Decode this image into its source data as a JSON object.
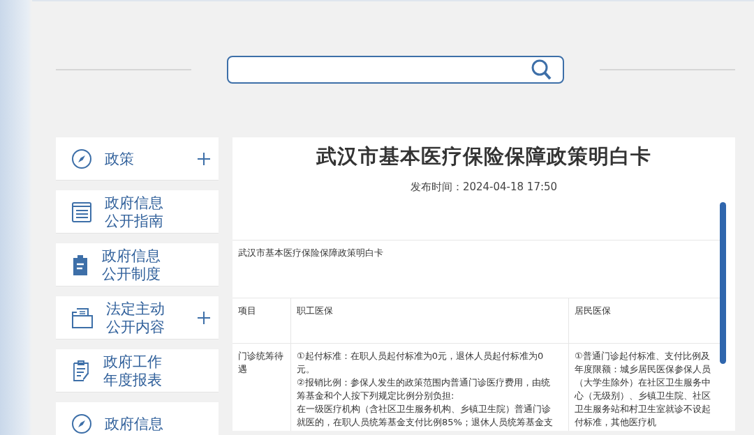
{
  "sidebar": {
    "items": [
      {
        "kind": "compass",
        "lines": [
          "政策"
        ],
        "expandable": true
      },
      {
        "kind": "list",
        "lines": [
          "政府信息",
          "公开指南"
        ],
        "expandable": false
      },
      {
        "kind": "clipboard",
        "lines": [
          "政府信息",
          "公开制度"
        ],
        "expandable": false
      },
      {
        "kind": "folder",
        "lines": [
          "法定主动",
          "公开内容"
        ],
        "expandable": true
      },
      {
        "kind": "report",
        "lines": [
          "政府工作",
          "年度报表"
        ],
        "expandable": false
      },
      {
        "kind": "compass",
        "lines": [
          "政府信息"
        ],
        "expandable": false
      }
    ]
  },
  "article": {
    "title": "武汉市基本医疗保险保障政策明白卡",
    "date_label": "发布时间：",
    "date": "2024-04-18 17:50",
    "table": {
      "caption": "武汉市基本医疗保险保障政策明白卡",
      "header": [
        "项目",
        "职工医保",
        "居民医保"
      ],
      "rows": [
        {
          "cells": [
            [
              "门诊统筹待遇"
            ],
            [
              "①起付标准：在职人员起付标准为0元，退休人员起付标准为0元。",
              "②报销比例：参保人发生的政策范围内普通门诊医疗费用，由统筹基金和个人按下列规定比例分别负担:",
              "在一级医疗机构（含社区卫生服务机构、乡镇卫生院）普通门诊就医的，在职人员统筹基金支付比例85%；退休人员统筹基金支"
            ],
            [
              "①普通门诊起付标准、支付比例及年度限额：城乡居民医保参保人员（大学生除外）在社区卫生服务中心（无级别）、乡镇卫生院、社区卫生服务站和村卫生室就诊不设起付标准，其他医疗机"
            ]
          ]
        }
      ]
    }
  }
}
